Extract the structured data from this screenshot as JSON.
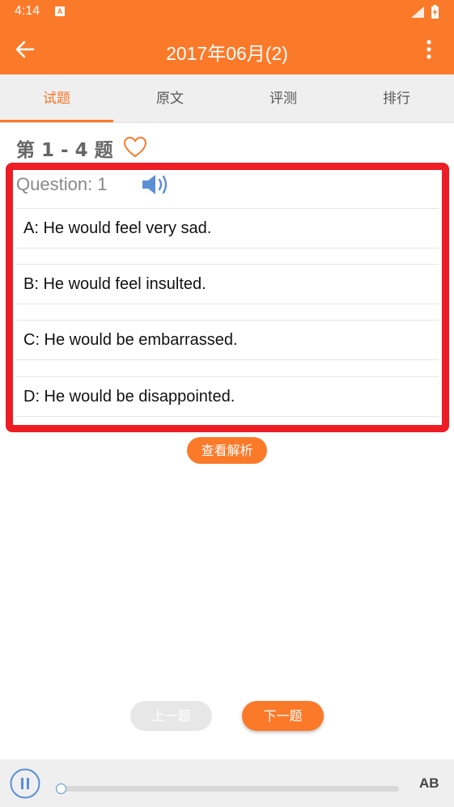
{
  "status_bar": {
    "time": "4:14",
    "notification_icon": "A"
  },
  "app_bar": {
    "title": "2017年06月(2)",
    "back_icon": "arrow-left-icon",
    "menu_icon": "more-vert-icon"
  },
  "tabs": [
    {
      "label": "试题",
      "active": true
    },
    {
      "label": "原文",
      "active": false
    },
    {
      "label": "评测",
      "active": false
    },
    {
      "label": "排行",
      "active": false
    }
  ],
  "question_range": "第 1 - 4 题",
  "question": {
    "label": "Question: 1",
    "options": [
      "A: He would feel very sad.",
      "B: He would feel insulted.",
      "C: He would be embarrassed.",
      "D: He would be disappointed."
    ]
  },
  "analysis_button": "查看解析",
  "nav": {
    "prev": "上一题",
    "next": "下一题"
  },
  "player": {
    "ab_label": "AB",
    "progress": 0
  },
  "colors": {
    "accent": "#fb7a2a",
    "highlight_border": "#ee1c25",
    "speaker": "#5a8fd6"
  }
}
